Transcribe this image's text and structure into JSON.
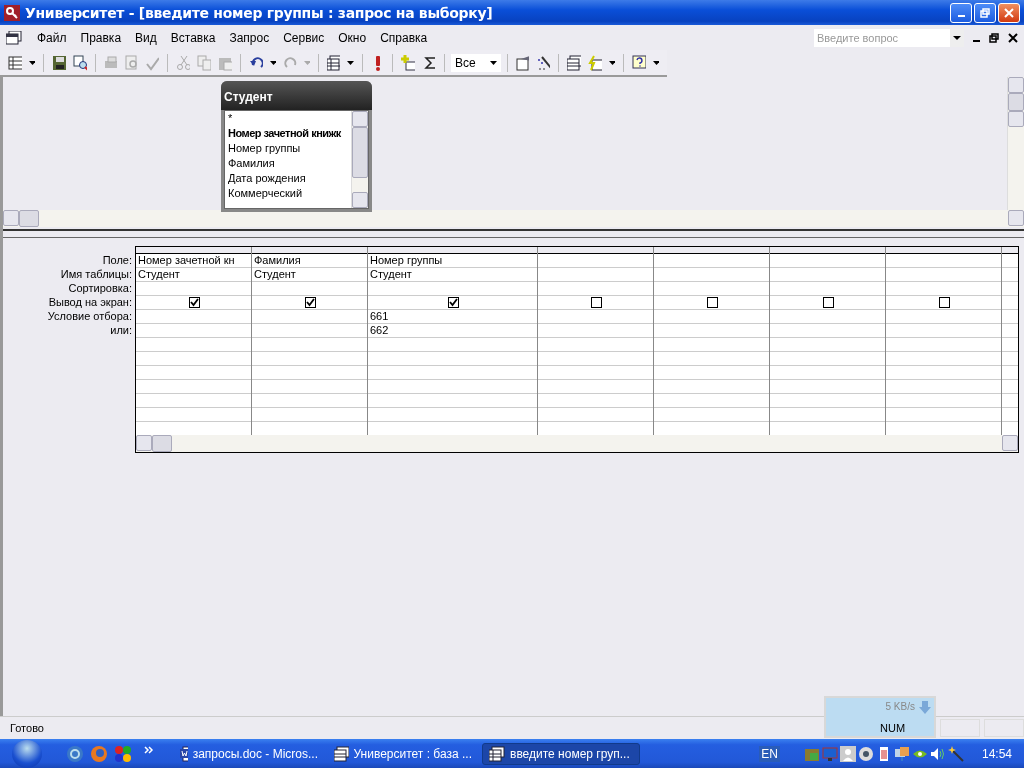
{
  "window": {
    "title": "Университет - [введите номер группы : запрос на выборку]"
  },
  "menu": [
    "Файл",
    "Правка",
    "Вид",
    "Вставка",
    "Запрос",
    "Сервис",
    "Окно",
    "Справка"
  ],
  "help_box": {
    "placeholder": "Введите вопрос"
  },
  "toolbar": {
    "top_values": "Все"
  },
  "table_box": {
    "title": "Студент",
    "fields": [
      {
        "name": "*",
        "key": false
      },
      {
        "name": "Номер зачетной книжк",
        "key": true
      },
      {
        "name": "Номер группы",
        "key": false
      },
      {
        "name": "Фамилия",
        "key": false
      },
      {
        "name": "Дата рождения",
        "key": false
      },
      {
        "name": "Коммерческий",
        "key": false
      }
    ]
  },
  "grid": {
    "row_labels": [
      "Поле:",
      "Имя таблицы:",
      "Сортировка:",
      "Вывод на экран:",
      "Условие отбора:",
      "или:"
    ],
    "columns": [
      {
        "field": "Номер зачетной кн",
        "table": "Студент",
        "show": true
      },
      {
        "field": "Фамилия",
        "table": "Студент",
        "show": true
      },
      {
        "field": "Номер группы",
        "table": "Студент",
        "show": true,
        "criteria": "661",
        "or": "662"
      },
      {
        "show": false
      },
      {
        "show": false
      },
      {
        "show": false
      },
      {
        "show": false
      }
    ]
  },
  "status_bar": {
    "text": "Готово",
    "indicator": "NUM"
  },
  "network_meter": {
    "speed": "5 KB/s"
  },
  "taskbar": {
    "tasks": [
      {
        "label": "запросы.doc - Micros...",
        "kind": "document",
        "selected": false
      },
      {
        "label": "Университет : база ...",
        "kind": "database",
        "selected": false
      },
      {
        "label": "введите номер груп...",
        "kind": "query",
        "selected": true
      }
    ],
    "language": "EN",
    "clock": "14:54"
  }
}
